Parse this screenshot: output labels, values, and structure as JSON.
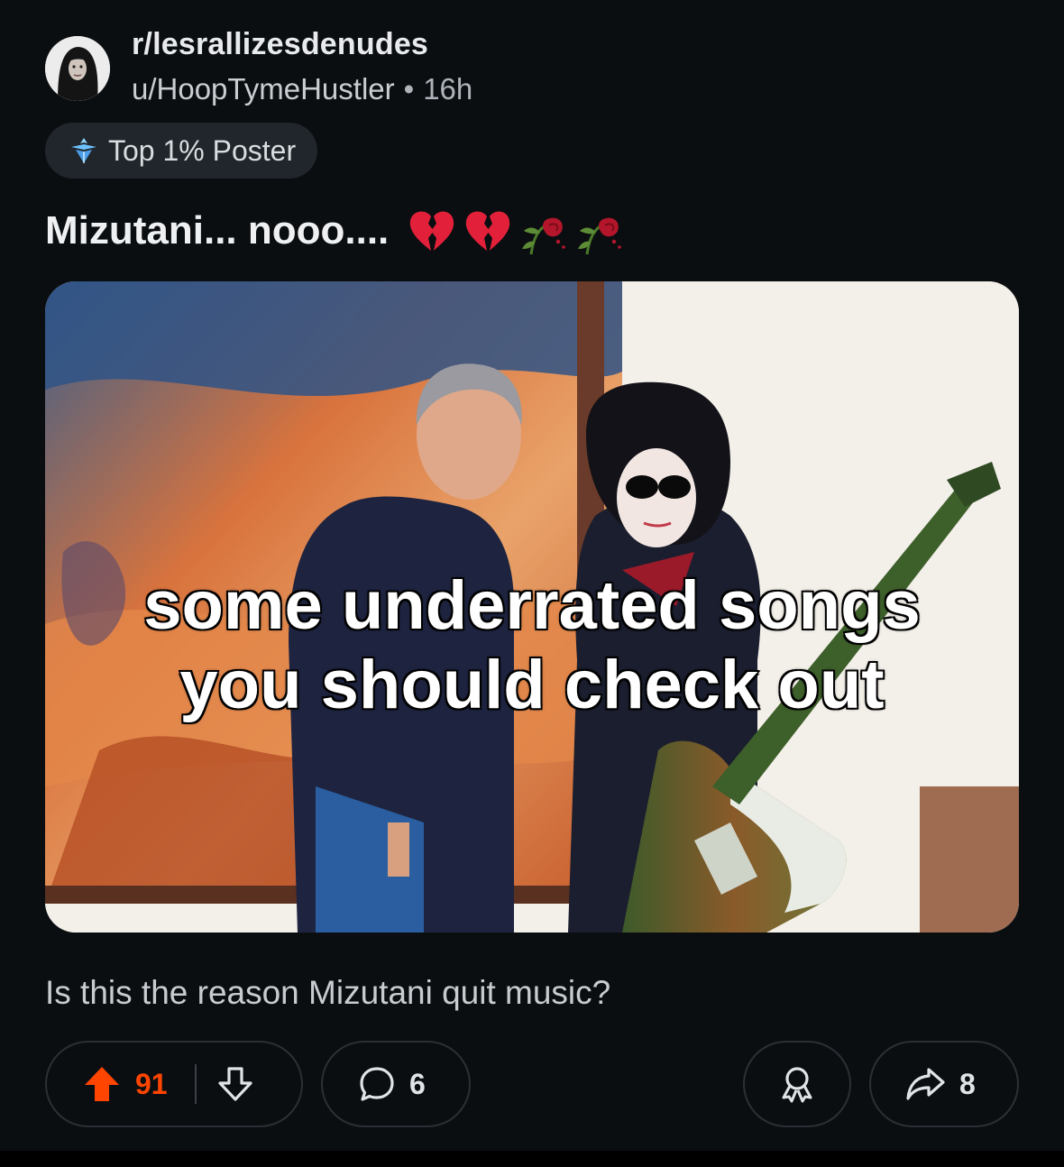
{
  "post": {
    "subreddit": "r/lesrallizesdenudes",
    "username": "u/HoopTymeHustler",
    "separator": "•",
    "age": "16h",
    "flair": "Top 1% Poster",
    "title": "Mizutani... nooo....",
    "title_emojis": [
      "broken-heart",
      "broken-heart",
      "wilted-rose",
      "wilted-rose"
    ],
    "image_caption_line1": "some underrated songs",
    "image_caption_line2": "you should check out",
    "body": "Is this the reason Mizutani quit music?"
  },
  "actions": {
    "upvotes": "91",
    "comments": "6",
    "shares": "8"
  },
  "colors": {
    "background": "#0b0e11",
    "upvote_active": "#ff4500",
    "pill_border": "#2a3035"
  }
}
